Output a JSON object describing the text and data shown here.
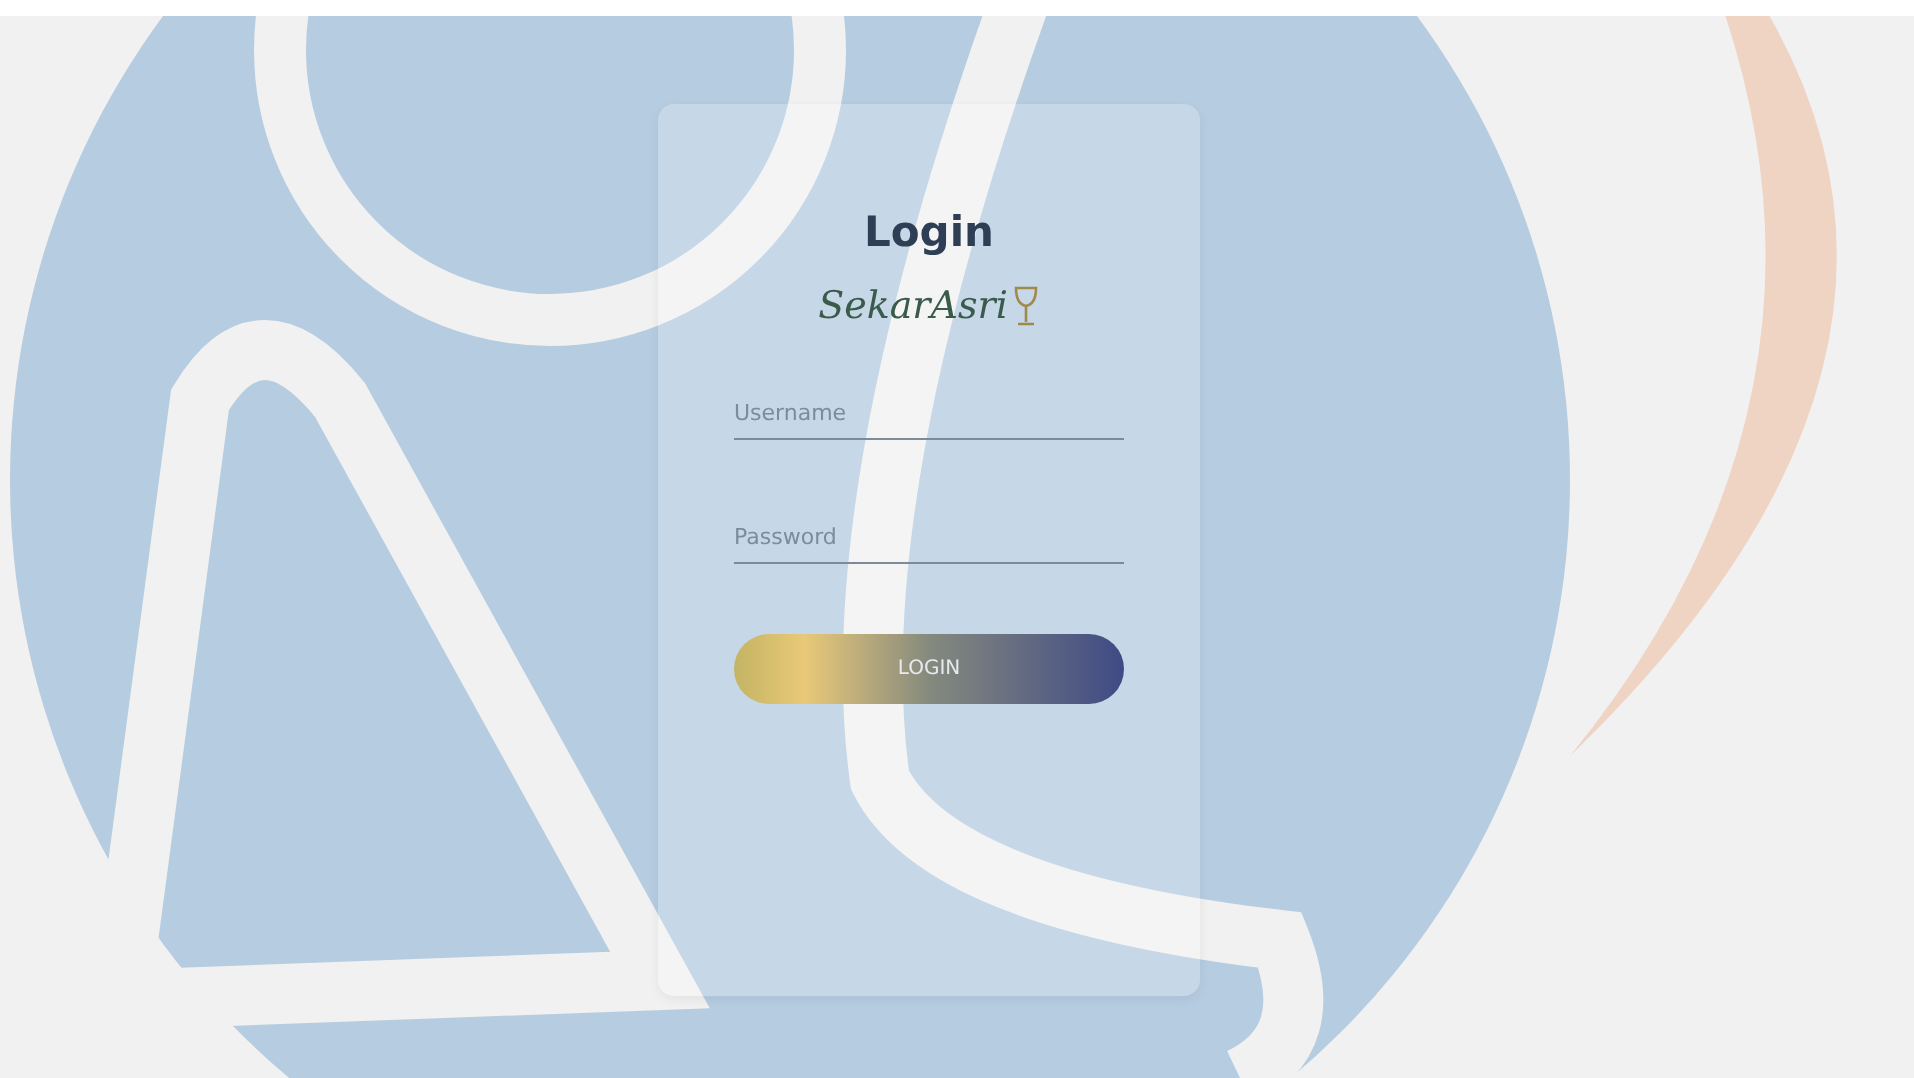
{
  "card": {
    "title": "Login",
    "logo_text": "SekarAsri"
  },
  "fields": [
    {
      "placeholder": "Username"
    },
    {
      "placeholder": "Password"
    }
  ],
  "button": {
    "label": "LOGIN"
  }
}
